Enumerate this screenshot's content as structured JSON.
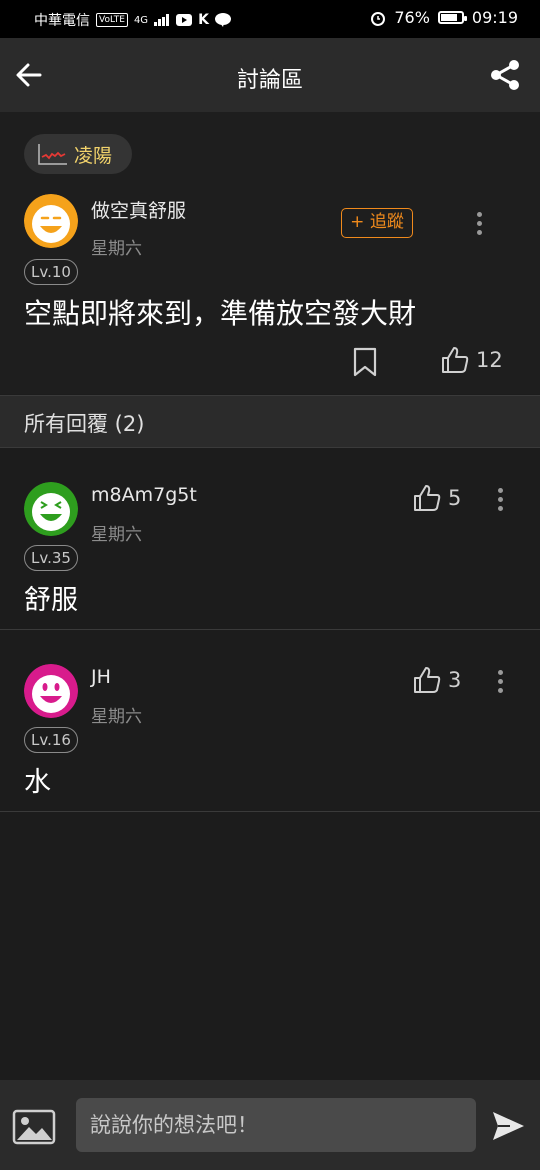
{
  "status_bar": {
    "carrier": "中華電信",
    "volte": "VoLTE",
    "network": "4G",
    "battery": "76%",
    "time": "09:19"
  },
  "header": {
    "title": "討論區"
  },
  "post": {
    "tag_label": "凌陽",
    "author": "做空真舒服",
    "date": "星期六",
    "level": "Lv.10",
    "follow_label": "+ 追蹤",
    "content": "空點即將來到，準備放空發大財",
    "likes": "12"
  },
  "replies_header": "所有回覆 (2)",
  "replies": [
    {
      "author": "m8Am7g5t",
      "date": "星期六",
      "level": "Lv.35",
      "content": "舒服",
      "likes": "5",
      "avatar_color": "#2e9e1e"
    },
    {
      "author": "JH",
      "date": "星期六",
      "level": "Lv.16",
      "content": "水",
      "likes": "3",
      "avatar_color": "#d81b8c"
    }
  ],
  "composer": {
    "placeholder": "說說你的想法吧！"
  },
  "colors": {
    "accent": "#f08a1c",
    "tag_text": "#f2d36b",
    "post_avatar": "#f5a21b"
  }
}
